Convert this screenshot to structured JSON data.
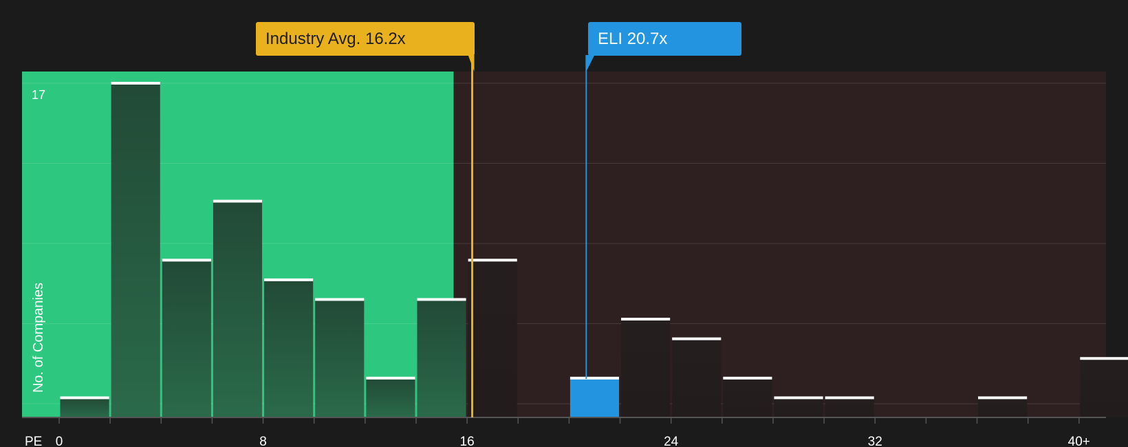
{
  "chart_data": {
    "type": "bar",
    "xlabel": "PE",
    "ylabel": "No. of Companies",
    "ytick_label": "17",
    "ymax": 17,
    "xlim": [
      -2,
      43
    ],
    "x_ticks": [
      {
        "value": 0,
        "label": "0"
      },
      {
        "value": 8,
        "label": "8"
      },
      {
        "value": 16,
        "label": "16"
      },
      {
        "value": 24,
        "label": "24"
      },
      {
        "value": 32,
        "label": "32"
      },
      {
        "value": 40,
        "label": "40+"
      }
    ],
    "bin_width": 2,
    "bins": [
      {
        "start": 0,
        "count": 1
      },
      {
        "start": 2,
        "count": 17
      },
      {
        "start": 4,
        "count": 8
      },
      {
        "start": 6,
        "count": 11
      },
      {
        "start": 8,
        "count": 7
      },
      {
        "start": 10,
        "count": 6
      },
      {
        "start": 12,
        "count": 2
      },
      {
        "start": 14,
        "count": 6
      },
      {
        "start": 16,
        "count": 8
      },
      {
        "start": 18,
        "count": 0
      },
      {
        "start": 20,
        "count": 2,
        "highlight": true
      },
      {
        "start": 22,
        "count": 5
      },
      {
        "start": 24,
        "count": 4
      },
      {
        "start": 26,
        "count": 2
      },
      {
        "start": 28,
        "count": 1
      },
      {
        "start": 30,
        "count": 1
      },
      {
        "start": 32,
        "count": 0
      },
      {
        "start": 34,
        "count": 0
      },
      {
        "start": 36,
        "count": 1
      },
      {
        "start": 38,
        "count": 0
      },
      {
        "start": 40,
        "count": 3
      }
    ],
    "industry_avg": {
      "value": 16.2,
      "label": "Industry Avg. 16.2x"
    },
    "company": {
      "name": "ELI",
      "value": 20.7,
      "label": "ELI 20.7x"
    },
    "grid": true,
    "colors": {
      "background": "#1b1b1b",
      "below_avg_region": "#2ec780",
      "above_avg_region": "#2e1f20",
      "bar_below": "#224a36",
      "bar_above": "#241e1e",
      "highlight": "#2394e0",
      "industry": "#eab11f",
      "bar_cap": "#ffffff"
    }
  }
}
